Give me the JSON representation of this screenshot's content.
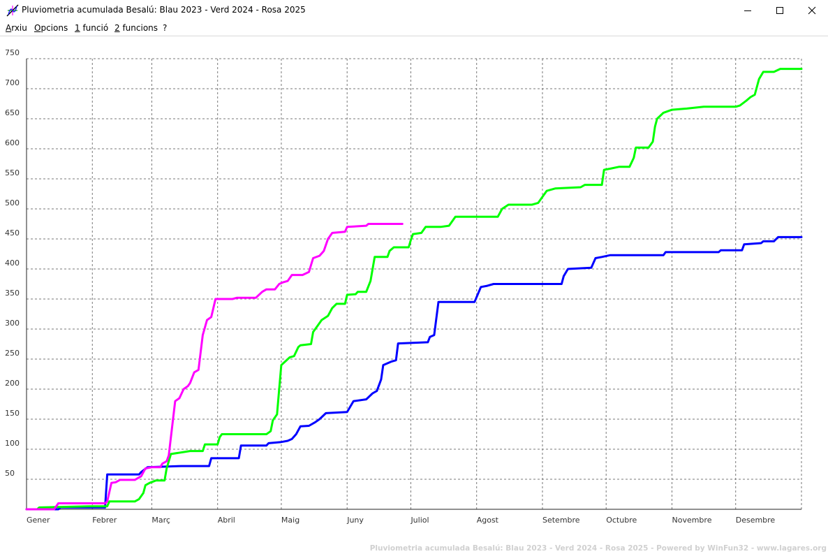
{
  "window": {
    "title": "Pluviometria acumulada Besalú: Blau 2023 - Verd 2024 - Rosa 2025",
    "icon": "function-plot-icon"
  },
  "menu": {
    "items": [
      "Arxiu",
      "Opcions",
      "1 funció",
      "2 funcions",
      "?"
    ]
  },
  "footer": "Pluviometria acumulada Besalú: Blau 2023 - Verd 2024 - Rosa 2025 - Powered by WinFun32 - www.lagares.org",
  "chart_data": {
    "type": "line",
    "title": "",
    "xlabel": "",
    "ylabel": "",
    "xlim": [
      1,
      366
    ],
    "ylim": [
      0,
      750
    ],
    "grid": true,
    "x_ticks": [
      {
        "day": 1,
        "label": "Gener"
      },
      {
        "day": 32,
        "label": "Febrer"
      },
      {
        "day": 60,
        "label": "Març"
      },
      {
        "day": 91,
        "label": "Abril"
      },
      {
        "day": 121,
        "label": "Maig"
      },
      {
        "day": 152,
        "label": "Juny"
      },
      {
        "day": 182,
        "label": "Juliol"
      },
      {
        "day": 213,
        "label": "Agost"
      },
      {
        "day": 244,
        "label": "Setembre"
      },
      {
        "day": 274,
        "label": "Octubre"
      },
      {
        "day": 305,
        "label": "Novembre"
      },
      {
        "day": 335,
        "label": "Desembre"
      }
    ],
    "y_ticks": [
      50,
      100,
      150,
      200,
      250,
      300,
      350,
      400,
      450,
      500,
      550,
      600,
      650,
      700,
      750
    ],
    "series": [
      {
        "color": "#0000ff",
        "points": [
          [
            1,
            0
          ],
          [
            16,
            0
          ],
          [
            17,
            3
          ],
          [
            32,
            3
          ],
          [
            38,
            3
          ],
          [
            39,
            58
          ],
          [
            54,
            58
          ],
          [
            55,
            62
          ],
          [
            58,
            70
          ],
          [
            74,
            72
          ],
          [
            87,
            72
          ],
          [
            88,
            85
          ],
          [
            101,
            85
          ],
          [
            102,
            106
          ],
          [
            114,
            106
          ],
          [
            115,
            110
          ],
          [
            121,
            112
          ],
          [
            124,
            114
          ],
          [
            126,
            117
          ],
          [
            128,
            125
          ],
          [
            130,
            138
          ],
          [
            134,
            139
          ],
          [
            137,
            145
          ],
          [
            139,
            150
          ],
          [
            142,
            160
          ],
          [
            152,
            162
          ],
          [
            155,
            180
          ],
          [
            161,
            183
          ],
          [
            164,
            193
          ],
          [
            166,
            197
          ],
          [
            168,
            216
          ],
          [
            169,
            240
          ],
          [
            173,
            246
          ],
          [
            175,
            248
          ],
          [
            176,
            276
          ],
          [
            190,
            278
          ],
          [
            191,
            287
          ],
          [
            193,
            290
          ],
          [
            195,
            345
          ],
          [
            212,
            345
          ],
          [
            215,
            370
          ],
          [
            218,
            372
          ],
          [
            221,
            375
          ],
          [
            253,
            375
          ],
          [
            254,
            388
          ],
          [
            256,
            400
          ],
          [
            267,
            402
          ],
          [
            269,
            418
          ],
          [
            272,
            420
          ],
          [
            276,
            423
          ],
          [
            301,
            423
          ],
          [
            302,
            428
          ],
          [
            327,
            428
          ],
          [
            328,
            431
          ],
          [
            338,
            431
          ],
          [
            339,
            441
          ],
          [
            347,
            443
          ],
          [
            348,
            446
          ],
          [
            353,
            446
          ],
          [
            355,
            453
          ],
          [
            366,
            453
          ]
        ]
      },
      {
        "color": "#00ff00",
        "points": [
          [
            1,
            0
          ],
          [
            6,
            0
          ],
          [
            7,
            3
          ],
          [
            31,
            5
          ],
          [
            39,
            5
          ],
          [
            40,
            13
          ],
          [
            52,
            13
          ],
          [
            54,
            17
          ],
          [
            56,
            27
          ],
          [
            57,
            40
          ],
          [
            59,
            44
          ],
          [
            62,
            48
          ],
          [
            66,
            48
          ],
          [
            67,
            68
          ],
          [
            69,
            92
          ],
          [
            78,
            97
          ],
          [
            84,
            97
          ],
          [
            85,
            108
          ],
          [
            91,
            108
          ],
          [
            92,
            120
          ],
          [
            93,
            125
          ],
          [
            114,
            125
          ],
          [
            116,
            130
          ],
          [
            117,
            148
          ],
          [
            119,
            158
          ],
          [
            120,
            200
          ],
          [
            121,
            240
          ],
          [
            125,
            253
          ],
          [
            127,
            255
          ],
          [
            129,
            270
          ],
          [
            130,
            273
          ],
          [
            135,
            275
          ],
          [
            136,
            295
          ],
          [
            138,
            305
          ],
          [
            140,
            315
          ],
          [
            143,
            322
          ],
          [
            145,
            335
          ],
          [
            147,
            342
          ],
          [
            151,
            342
          ],
          [
            152,
            357
          ],
          [
            156,
            358
          ],
          [
            157,
            362
          ],
          [
            161,
            362
          ],
          [
            163,
            380
          ],
          [
            164,
            400
          ],
          [
            165,
            420
          ],
          [
            171,
            420
          ],
          [
            172,
            430
          ],
          [
            174,
            436
          ],
          [
            181,
            436
          ],
          [
            182,
            448
          ],
          [
            183,
            458
          ],
          [
            187,
            460
          ],
          [
            189,
            470
          ],
          [
            196,
            470
          ],
          [
            200,
            472
          ],
          [
            203,
            487
          ],
          [
            223,
            487
          ],
          [
            225,
            500
          ],
          [
            228,
            507
          ],
          [
            239,
            507
          ],
          [
            242,
            510
          ],
          [
            244,
            520
          ],
          [
            246,
            530
          ],
          [
            250,
            534
          ],
          [
            262,
            536
          ],
          [
            264,
            540
          ],
          [
            272,
            540
          ],
          [
            273,
            565
          ],
          [
            276,
            567
          ],
          [
            280,
            570
          ],
          [
            285,
            570
          ],
          [
            287,
            585
          ],
          [
            288,
            602
          ],
          [
            294,
            602
          ],
          [
            296,
            612
          ],
          [
            297,
            637
          ],
          [
            298,
            650
          ],
          [
            301,
            660
          ],
          [
            305,
            665
          ],
          [
            312,
            667
          ],
          [
            320,
            670
          ],
          [
            335,
            670
          ],
          [
            337,
            672
          ],
          [
            340,
            680
          ],
          [
            342,
            686
          ],
          [
            344,
            690
          ],
          [
            346,
            716
          ],
          [
            348,
            728
          ],
          [
            353,
            728
          ],
          [
            356,
            733
          ],
          [
            366,
            733
          ]
        ]
      },
      {
        "color": "#ff00ff",
        "points": [
          [
            1,
            0
          ],
          [
            14,
            0
          ],
          [
            16,
            10
          ],
          [
            38,
            10
          ],
          [
            39,
            13
          ],
          [
            41,
            44
          ],
          [
            43,
            45
          ],
          [
            45,
            49
          ],
          [
            52,
            49
          ],
          [
            55,
            55
          ],
          [
            57,
            68
          ],
          [
            60,
            70
          ],
          [
            64,
            70
          ],
          [
            65,
            76
          ],
          [
            66,
            78
          ],
          [
            67,
            80
          ],
          [
            68,
            90
          ],
          [
            69,
            120
          ],
          [
            71,
            180
          ],
          [
            73,
            185
          ],
          [
            75,
            200
          ],
          [
            77,
            205
          ],
          [
            78,
            210
          ],
          [
            80,
            228
          ],
          [
            82,
            232
          ],
          [
            84,
            290
          ],
          [
            86,
            315
          ],
          [
            88,
            320
          ],
          [
            90,
            350
          ],
          [
            98,
            350
          ],
          [
            100,
            352
          ],
          [
            109,
            352
          ],
          [
            112,
            362
          ],
          [
            114,
            366
          ],
          [
            118,
            366
          ],
          [
            120,
            375
          ],
          [
            122,
            378
          ],
          [
            124,
            380
          ],
          [
            126,
            390
          ],
          [
            131,
            390
          ],
          [
            134,
            395
          ],
          [
            136,
            418
          ],
          [
            139,
            422
          ],
          [
            141,
            430
          ],
          [
            143,
            450
          ],
          [
            145,
            460
          ],
          [
            151,
            462
          ],
          [
            152,
            470
          ],
          [
            161,
            472
          ],
          [
            162,
            475
          ],
          [
            178,
            475
          ]
        ]
      }
    ]
  }
}
